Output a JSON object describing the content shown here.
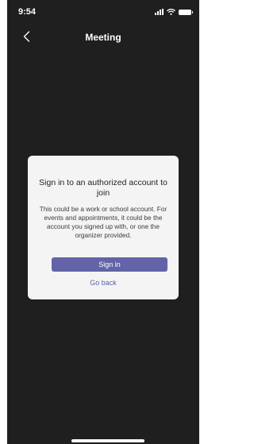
{
  "status_bar": {
    "time": "9:54",
    "icons": [
      "signal-icon",
      "wifi-icon",
      "battery-icon"
    ]
  },
  "nav": {
    "back_icon": "chevron-left-icon",
    "title": "Meeting"
  },
  "dialog": {
    "title": "Sign in to an authorized account to join",
    "body": "This could be a work or school account. For events and appointments, it could be the account you signed up with, or one the organizer provided.",
    "primary_button": "Sign in",
    "secondary_link": "Go back"
  },
  "colors": {
    "background": "#1f1f1f",
    "dialog": "#f4f4f4",
    "accent": "#6264a7"
  }
}
